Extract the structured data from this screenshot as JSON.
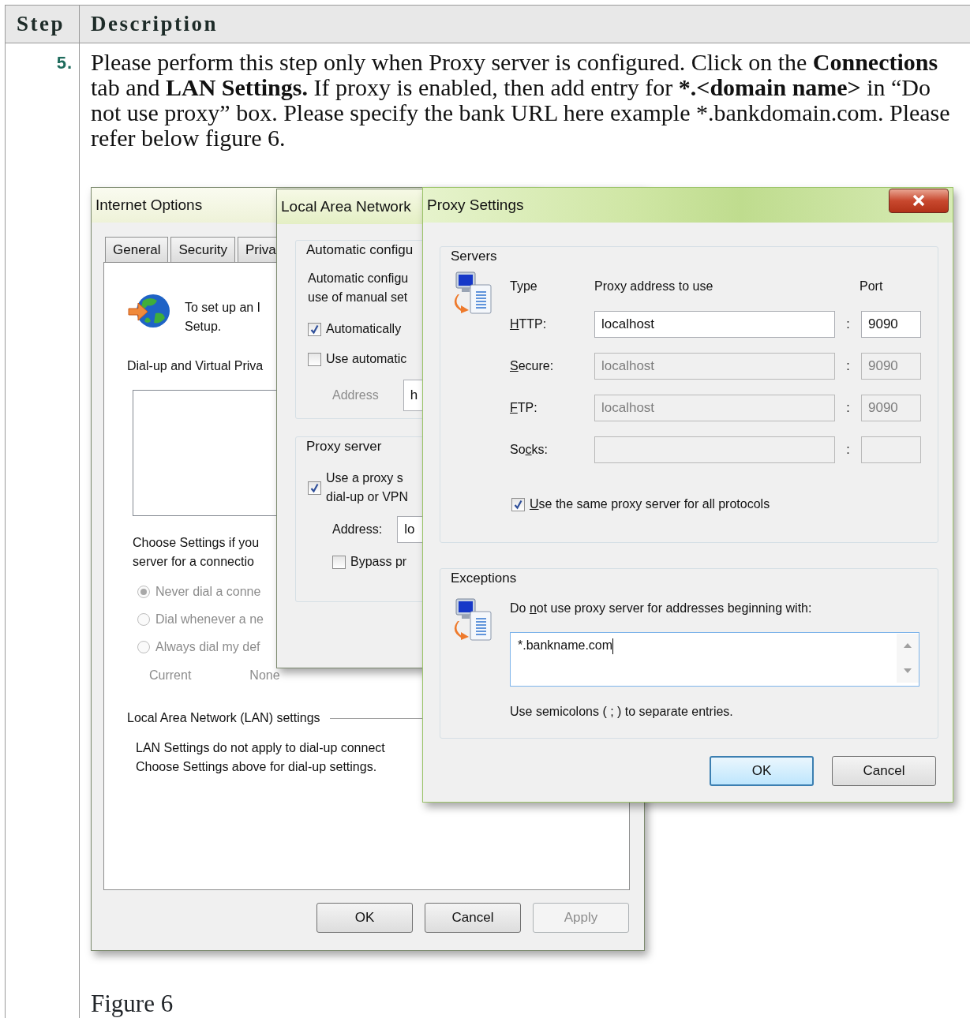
{
  "document": {
    "columns": [
      "Step",
      "Description"
    ]
  },
  "step": {
    "number": "5.",
    "description": [
      {
        "text": "Please perform this step only when Proxy server is configured. Click on the ",
        "bold": false
      },
      {
        "text": "Connections",
        "bold": true
      },
      {
        "text": " tab and ",
        "bold": false
      },
      {
        "text": "LAN Settings.",
        "bold": true
      },
      {
        "text": " If proxy is enabled, then add entry for ",
        "bold": false
      },
      {
        "text": "*.<domain name>",
        "bold": true
      },
      {
        "text": " in “Do not use proxy” box. Please specify the bank URL here example *.bankdomain.com. Please refer below figure 6.",
        "bold": false
      }
    ],
    "caption": "Figure 6"
  },
  "internet_options": {
    "title": "Internet Options",
    "tabs": [
      {
        "label": "General",
        "selected": false
      },
      {
        "label": "Security",
        "selected": false
      },
      {
        "label": "Priva",
        "selected": false
      }
    ],
    "setup_text": [
      "To set up an I",
      "Setup."
    ],
    "dialup_heading": "Dial-up and Virtual Priva",
    "choose_text": [
      "Choose Settings if you",
      "server for a connectio"
    ],
    "radios": [
      {
        "label": "Never dial a conne",
        "selected": true,
        "disabled": true
      },
      {
        "label": "Dial whenever a ne",
        "selected": false,
        "disabled": true
      },
      {
        "label": "Always dial my def",
        "selected": false,
        "disabled": true
      }
    ],
    "current_label": "Current",
    "current_value": "None",
    "lan_heading": "Local Area Network (LAN) settings",
    "lan_text": [
      "LAN Settings do not apply to dial-up connect",
      "Choose Settings above for dial-up settings."
    ],
    "buttons": [
      {
        "label": "OK",
        "disabled": false
      },
      {
        "label": "Cancel",
        "disabled": false
      },
      {
        "label": "Apply",
        "disabled": true
      }
    ]
  },
  "lan_settings": {
    "title": "Local Area Network",
    "auto_group": {
      "title": "Automatic configu",
      "text": [
        "Automatic configu",
        "use of manual set"
      ],
      "checkboxes": [
        {
          "label": "Automatically",
          "checked": true
        },
        {
          "label": "Use automatic",
          "checked": false
        }
      ],
      "address_label": "Address",
      "address_value": "h"
    },
    "proxy_group": {
      "title": "Proxy server",
      "use_proxy": {
        "label": [
          "Use a proxy s",
          "dial-up or VPN"
        ],
        "checked": true
      },
      "address_label": "Address:",
      "address_value": "lo",
      "bypass": {
        "label": "Bypass pr",
        "checked": false
      }
    }
  },
  "proxy_settings": {
    "title": "Proxy Settings",
    "servers": {
      "title": "Servers",
      "headers": [
        "Type",
        "Proxy address to use",
        "Port"
      ],
      "rows": [
        {
          "label": [
            {
              "text": "H",
              "underline": true
            },
            {
              "text": "TTP:",
              "underline": false
            }
          ],
          "address": "localhost",
          "separator": ":",
          "port": "9090",
          "disabled": false
        },
        {
          "label": [
            {
              "text": "S",
              "underline": true
            },
            {
              "text": "ecure:",
              "underline": false
            }
          ],
          "address": "localhost",
          "separator": ":",
          "port": "9090",
          "disabled": true
        },
        {
          "label": [
            {
              "text": "F",
              "underline": true
            },
            {
              "text": "TP:",
              "underline": false
            }
          ],
          "address": "localhost",
          "separator": ":",
          "port": "9090",
          "disabled": true
        },
        {
          "label": [
            {
              "text": "So",
              "underline": false
            },
            {
              "text": "c",
              "underline": true
            },
            {
              "text": "ks:",
              "underline": false
            }
          ],
          "separator": ":",
          "disabled": true
        }
      ],
      "same_proxy": {
        "label": [
          {
            "text": "U",
            "underline": true
          },
          {
            "text": "se the same proxy server for all protocols",
            "underline": false
          }
        ],
        "checked": true
      }
    },
    "exceptions": {
      "title": "Exceptions",
      "label": [
        {
          "text": "Do ",
          "underline": false
        },
        {
          "text": "n",
          "underline": true
        },
        {
          "text": "ot use proxy server for addresses beginning with:",
          "underline": false
        }
      ],
      "value": "*.bankname.com",
      "hint": "Use semicolons ( ; ) to separate entries."
    },
    "buttons": [
      {
        "label": "OK",
        "default": true
      },
      {
        "label": "Cancel",
        "default": false
      }
    ]
  }
}
